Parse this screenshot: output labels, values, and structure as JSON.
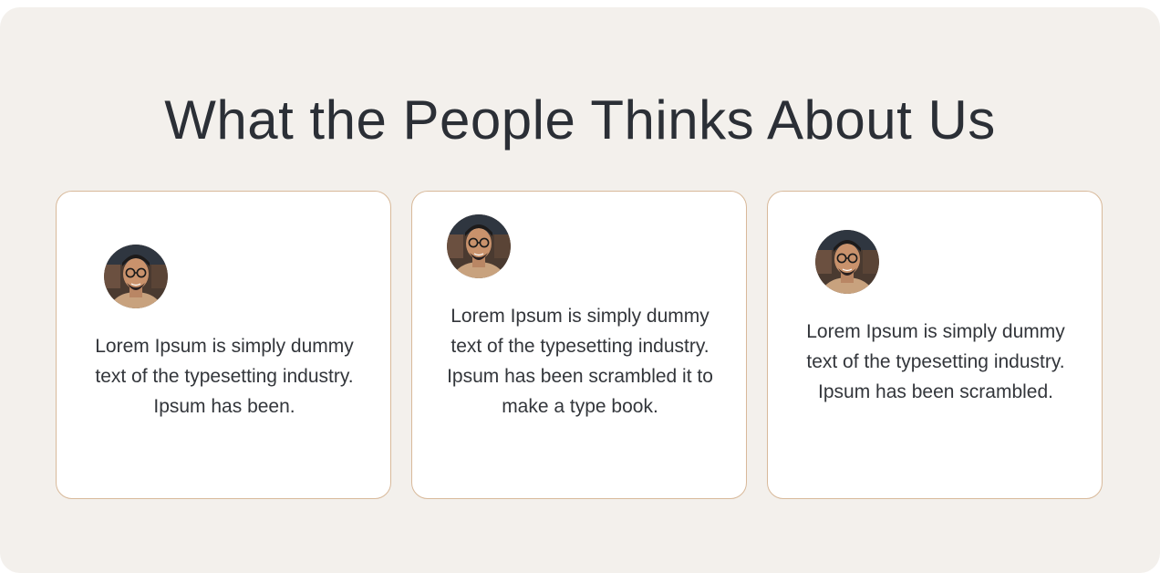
{
  "section": {
    "title": "What the People Thinks About Us"
  },
  "testimonials": [
    {
      "avatar_icon": "person-photo",
      "text": "Lorem Ipsum is simply dummy text of the typesetting industry. Ipsum has been."
    },
    {
      "avatar_icon": "person-photo",
      "text": "Lorem Ipsum is simply dummy text of the typesetting industry. Ipsum has been scrambled it to make a type book."
    },
    {
      "avatar_icon": "person-photo",
      "text": "Lorem Ipsum is simply dummy text of the typesetting industry. Ipsum has been scrambled."
    }
  ],
  "colors": {
    "background": "#f3f0ec",
    "card_border": "#d8b99a",
    "title": "#2b2f36",
    "text": "#33363b"
  }
}
